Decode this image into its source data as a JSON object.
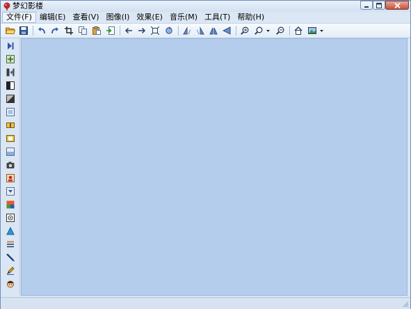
{
  "window": {
    "title": "梦幻影楼",
    "colors": {
      "frame": "#dbe6f4",
      "canvas": "#b5cded",
      "titlebar": "#d3e0f1",
      "close_button": "#c7503c"
    }
  },
  "caption_buttons": {
    "minimize": "minimize-icon",
    "maximize": "maximize-icon",
    "close": "close-icon"
  },
  "menubar": {
    "items": [
      {
        "label": "文件(F)"
      },
      {
        "label": "编辑(E)"
      },
      {
        "label": "查看(V)"
      },
      {
        "label": "图像(I)"
      },
      {
        "label": "效果(E)"
      },
      {
        "label": "音乐(M)"
      },
      {
        "label": "工具(T)"
      },
      {
        "label": "帮助(H)"
      }
    ]
  },
  "toolbar": {
    "buttons": [
      "open-folder-icon",
      "save-icon",
      "undo-icon",
      "redo-icon",
      "crop-icon",
      "copy-icon",
      "paste-icon",
      "import-icon",
      "previous-icon",
      "next-icon",
      "fit-icon",
      "rotate-icon",
      "flip-left-icon",
      "flip-right-icon",
      "mirror-icon",
      "triangle-left-icon",
      "zoom-in-icon",
      "zoom-dropdown-icon",
      "zoom-out-icon",
      "home-icon",
      "picture-icon"
    ]
  },
  "sidebar": {
    "tools": [
      "play-icon",
      "add-icon",
      "transition-icon",
      "split-icon",
      "contrast-icon",
      "frame-icon",
      "merge-icon",
      "film-icon",
      "panel-icon",
      "camera-icon",
      "photo-icon",
      "download-icon",
      "color-icon",
      "target-icon",
      "triangle-icon",
      "lines-icon",
      "pen-icon",
      "brush-icon",
      "face-icon"
    ]
  },
  "statusbar": {
    "text": ""
  }
}
